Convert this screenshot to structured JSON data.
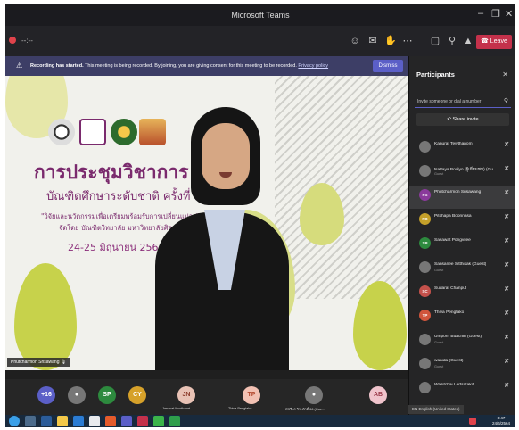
{
  "window": {
    "title": "Microsoft Teams",
    "minimize": "–",
    "maximize": "❐",
    "close": "✕"
  },
  "toolbar": {
    "timer": "--:--",
    "leave_label": "Leave"
  },
  "banner": {
    "lead": "Recording has started.",
    "text": " This meeting is being recorded. By joining, you are giving consent for this meeting to be recorded. ",
    "link": "Privacy policy",
    "dismiss": "Dismiss"
  },
  "slide": {
    "title": "การประชุมวิชาการ",
    "subtitle": "บัณฑิตศึกษาระดับชาติ ครั้งที่ 11",
    "theme": "\"วิจัยและนวัตกรรมเพื่อเตรียมพร้อมรับการเปลี่ยนแปลง\"",
    "organizer": "จัดโดย บัณฑิตวิทยาลัย มหาวิทยาลัยศิลปากร",
    "dates": "24-25 มิถุนายน 2564"
  },
  "speaker_label": "Phutcharmon Srisawang",
  "avatar_bar": {
    "overflow": "+16",
    "items": [
      {
        "initials": "SP",
        "color": "#2d8a3e"
      },
      {
        "initials": "CY",
        "color": "#d6a12a"
      },
      {
        "initials": "JN",
        "color": "#c4674b",
        "name": "Jaruwat Nuntharat"
      },
      {
        "initials": "TP",
        "color": "#d0553c",
        "name": "Thiva Pengtako"
      },
      {
        "initials": "",
        "color": "#777777",
        "name": "พัชรีพร วิระภักดิ์ 66 (Gue..."
      },
      {
        "initials": "AB",
        "color": "#b9505f"
      }
    ]
  },
  "panel": {
    "title": "Participants",
    "invite_placeholder": "Invite someone or dial a number",
    "share_invite": "Share invite",
    "participants": [
      {
        "name": "Kanurat Tewthanom",
        "status": "",
        "initials": "",
        "color": "#777777"
      },
      {
        "name": "Nattaya Boolyo (ผู้เยี่ยมชม) (Gu...",
        "status": "Guest",
        "initials": "",
        "color": "#777777"
      },
      {
        "name": "Phutcharmon Srisawang",
        "status": "",
        "initials": "PS",
        "color": "#8a3a9b",
        "selected": true
      },
      {
        "name": "Pitchapa Boonnasa",
        "status": "",
        "initials": "PB",
        "color": "#c4a02a"
      },
      {
        "name": "Sasawat Pongvilee",
        "status": "",
        "initials": "SP",
        "color": "#2d8a3e"
      },
      {
        "name": "Sansanee Sitthisak (Guest)",
        "status": "Guest",
        "initials": "",
        "color": "#777777"
      },
      {
        "name": "Sudarat Chanput",
        "status": "",
        "initials": "SC",
        "color": "#c4514b"
      },
      {
        "name": "Thiva Pengtako",
        "status": "",
        "initials": "TP",
        "color": "#d0553c"
      },
      {
        "name": "Umporn Buachin (Guest)",
        "status": "Guest",
        "initials": "",
        "color": "#777777"
      },
      {
        "name": "wanida (Guest)",
        "status": "Guest",
        "initials": "",
        "color": "#777777"
      },
      {
        "name": "Wasitchai Lertsatakit",
        "status": "",
        "initials": "",
        "color": "#777777"
      }
    ]
  },
  "taskbar": {
    "language": "EN English (United States)",
    "time": "8:47",
    "date": "24/6/2564"
  }
}
